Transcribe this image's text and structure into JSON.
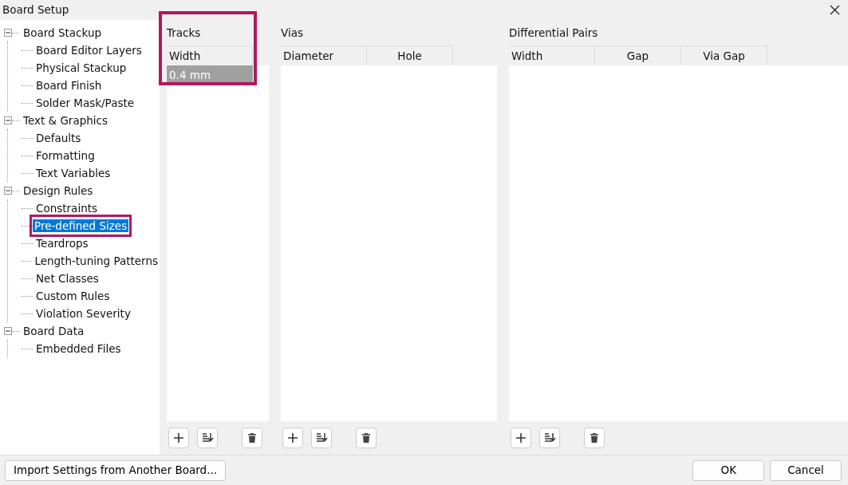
{
  "window": {
    "title": "Board Setup"
  },
  "sidebar": {
    "tree": [
      {
        "label": "Board Stackup",
        "expanded": true,
        "selected": false,
        "children": [
          {
            "label": "Board Editor Layers",
            "selected": false,
            "highlighted": false
          },
          {
            "label": "Physical Stackup",
            "selected": false,
            "highlighted": false
          },
          {
            "label": "Board Finish",
            "selected": false,
            "highlighted": false
          },
          {
            "label": "Solder Mask/Paste",
            "selected": false,
            "highlighted": false
          }
        ]
      },
      {
        "label": "Text & Graphics",
        "expanded": true,
        "selected": false,
        "children": [
          {
            "label": "Defaults",
            "selected": false,
            "highlighted": false
          },
          {
            "label": "Formatting",
            "selected": false,
            "highlighted": false
          },
          {
            "label": "Text Variables",
            "selected": false,
            "highlighted": false
          }
        ]
      },
      {
        "label": "Design Rules",
        "expanded": true,
        "selected": false,
        "children": [
          {
            "label": "Constraints",
            "selected": false,
            "highlighted": false
          },
          {
            "label": "Pre-defined Sizes",
            "selected": true,
            "highlighted": true
          },
          {
            "label": "Teardrops",
            "selected": false,
            "highlighted": false
          },
          {
            "label": "Length-tuning Patterns",
            "selected": false,
            "highlighted": false
          },
          {
            "label": "Net Classes",
            "selected": false,
            "highlighted": false
          },
          {
            "label": "Custom Rules",
            "selected": false,
            "highlighted": false
          },
          {
            "label": "Violation Severity",
            "selected": false,
            "highlighted": false
          }
        ]
      },
      {
        "label": "Board Data",
        "expanded": true,
        "selected": false,
        "children": [
          {
            "label": "Embedded Files",
            "selected": false,
            "highlighted": false
          }
        ]
      }
    ]
  },
  "panels": [
    {
      "title": "Tracks",
      "highlighted": true,
      "columns": [
        "Width"
      ],
      "rows": [
        {
          "cells": [
            "0.4 mm"
          ],
          "selected": true
        }
      ]
    },
    {
      "title": "Vias",
      "highlighted": false,
      "columns": [
        "Diameter",
        "Hole"
      ]
    },
    {
      "title": "Differential Pairs",
      "highlighted": false,
      "columns": [
        "Width",
        "Gap",
        "Via Gap"
      ]
    }
  ],
  "footer": {
    "left_button": "Import Settings from Another Board...",
    "buttons": [
      "OK",
      "Cancel"
    ]
  }
}
